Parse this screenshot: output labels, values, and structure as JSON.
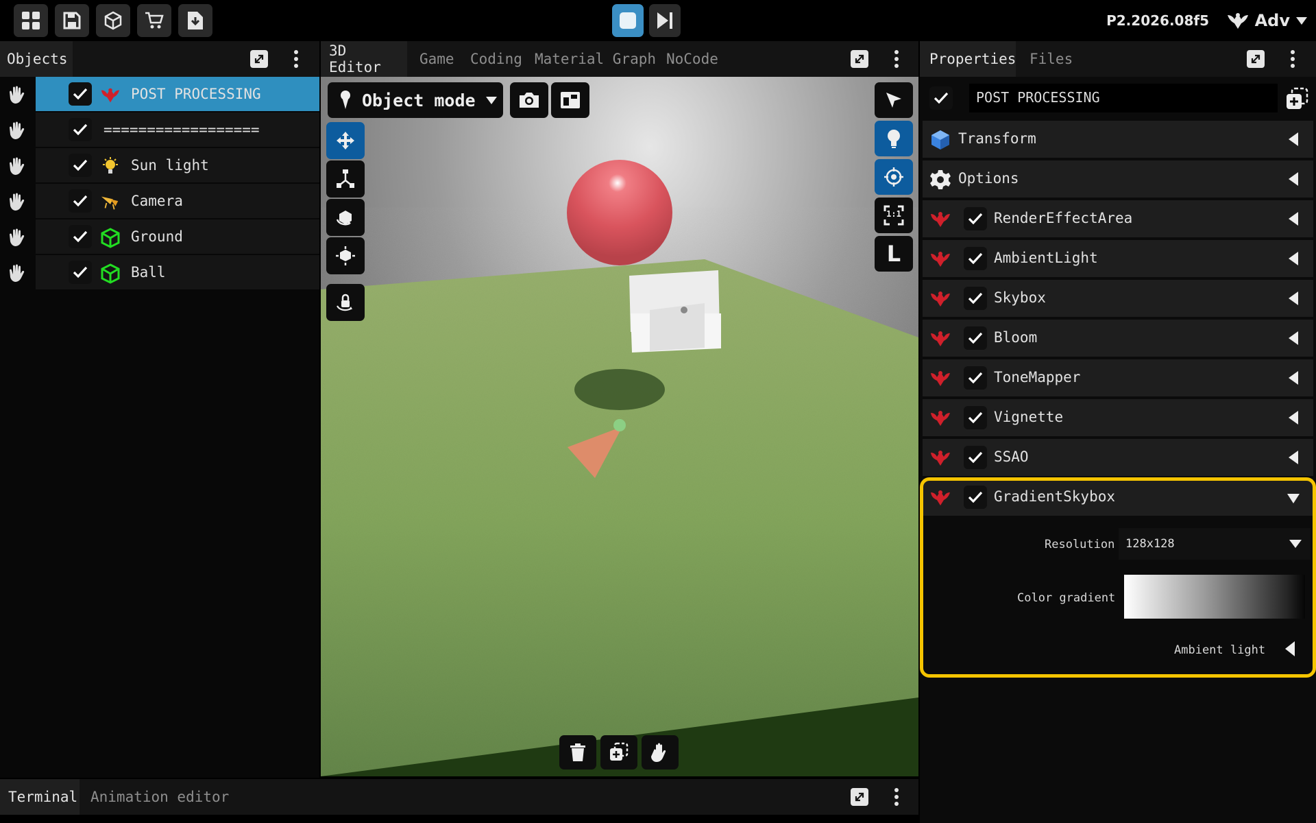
{
  "toolbar": {
    "items": [
      "grid-icon",
      "save-icon",
      "package-icon",
      "cart-icon",
      "download-icon"
    ],
    "version": "P2.2026.08f5",
    "user": "Adv"
  },
  "colors": {
    "accent": "#2f8fbf",
    "active_blue": "#0d5c9e",
    "highlight": "#f5c400",
    "post_processing_icon": "#d0202b",
    "mesh_icon": "#22dd22"
  },
  "objects_panel": {
    "tabs": [
      "Objects"
    ],
    "items": [
      {
        "label": "POST PROCESSING",
        "icon": "post-processing-icon",
        "checked": true,
        "selected": true
      },
      {
        "label": "==================",
        "icon": "",
        "checked": true,
        "selected": false
      },
      {
        "label": "Sun light",
        "icon": "light-bulb-icon",
        "checked": true,
        "selected": false
      },
      {
        "label": "Camera",
        "icon": "camera-icon",
        "checked": true,
        "selected": false
      },
      {
        "label": "Ground",
        "icon": "mesh-icon",
        "checked": true,
        "selected": false
      },
      {
        "label": "Ball",
        "icon": "mesh-icon",
        "checked": true,
        "selected": false
      }
    ]
  },
  "editor": {
    "tabs": [
      "3D Editor",
      "Game",
      "Coding",
      "Material Graph",
      "NoCode"
    ],
    "active_tab": "3D Editor",
    "mode": "Object mode",
    "right_tools": [
      "pointer-icon",
      "lightbulb-icon",
      "target-icon",
      "fit-view-icon",
      "local-space-icon"
    ],
    "right_tool_labels": {
      "fit": "1:1",
      "local": "L"
    },
    "left_tools": [
      "move-icon",
      "scale-icon",
      "rotate-icon",
      "transform-all-icon",
      "lock-camera-icon"
    ],
    "bottom_tools": [
      "trash-icon",
      "duplicate-icon",
      "grab-icon"
    ]
  },
  "properties": {
    "tabs": [
      "Properties",
      "Files"
    ],
    "active_tab": "Properties",
    "name": "POST PROCESSING",
    "sections": [
      {
        "label": "Transform",
        "icon": "cube-icon",
        "has_checkbox": false,
        "expanded": false
      },
      {
        "label": "Options",
        "icon": "gear-icon",
        "has_checkbox": false,
        "expanded": false
      },
      {
        "label": "RenderEffectArea",
        "icon": "post-processing-icon",
        "has_checkbox": true,
        "expanded": false
      },
      {
        "label": "AmbientLight",
        "icon": "post-processing-icon",
        "has_checkbox": true,
        "expanded": false
      },
      {
        "label": "Skybox",
        "icon": "post-processing-icon",
        "has_checkbox": true,
        "expanded": false
      },
      {
        "label": "Bloom",
        "icon": "post-processing-icon",
        "has_checkbox": true,
        "expanded": false
      },
      {
        "label": "ToneMapper",
        "icon": "post-processing-icon",
        "has_checkbox": true,
        "expanded": false
      },
      {
        "label": "Vignette",
        "icon": "post-processing-icon",
        "has_checkbox": true,
        "expanded": false
      },
      {
        "label": "SSAO",
        "icon": "post-processing-icon",
        "has_checkbox": true,
        "expanded": false
      },
      {
        "label": "GradientSkybox",
        "icon": "post-processing-icon",
        "has_checkbox": true,
        "expanded": true
      }
    ],
    "gradient_skybox": {
      "resolution_label": "Resolution",
      "resolution_value": "128x128",
      "color_gradient_label": "Color gradient",
      "ambient_light_label": "Ambient light"
    }
  },
  "bottom_panel": {
    "tabs": [
      "Terminal",
      "Animation editor"
    ],
    "active_tab": "Terminal"
  }
}
